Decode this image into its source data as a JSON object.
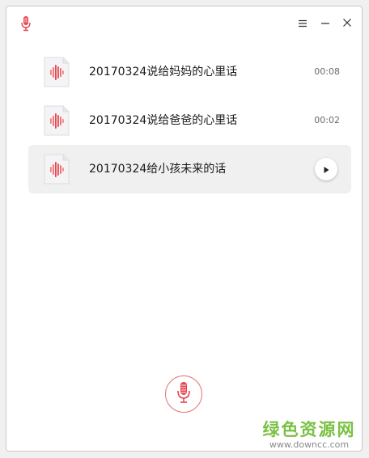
{
  "titlebar": {
    "app_icon": "microphone-icon",
    "menu_icon": "hamburger-menu-icon",
    "minimize_icon": "minimize-icon",
    "close_icon": "close-icon"
  },
  "recordings": [
    {
      "title": "20170324说给妈妈的心里话",
      "duration": "00:08",
      "selected": false
    },
    {
      "title": "20170324说给爸爸的心里话",
      "duration": "00:02",
      "selected": false
    },
    {
      "title": "20170324给小孩未来的话",
      "duration": "",
      "selected": true
    }
  ],
  "record_button": {
    "icon": "microphone-icon"
  },
  "watermark": {
    "title": "绿色资源网",
    "url": "www.downcc.com"
  },
  "colors": {
    "accent": "#e6444f",
    "selected_row": "#f0f0f0",
    "watermark_green": "#7ac143"
  }
}
